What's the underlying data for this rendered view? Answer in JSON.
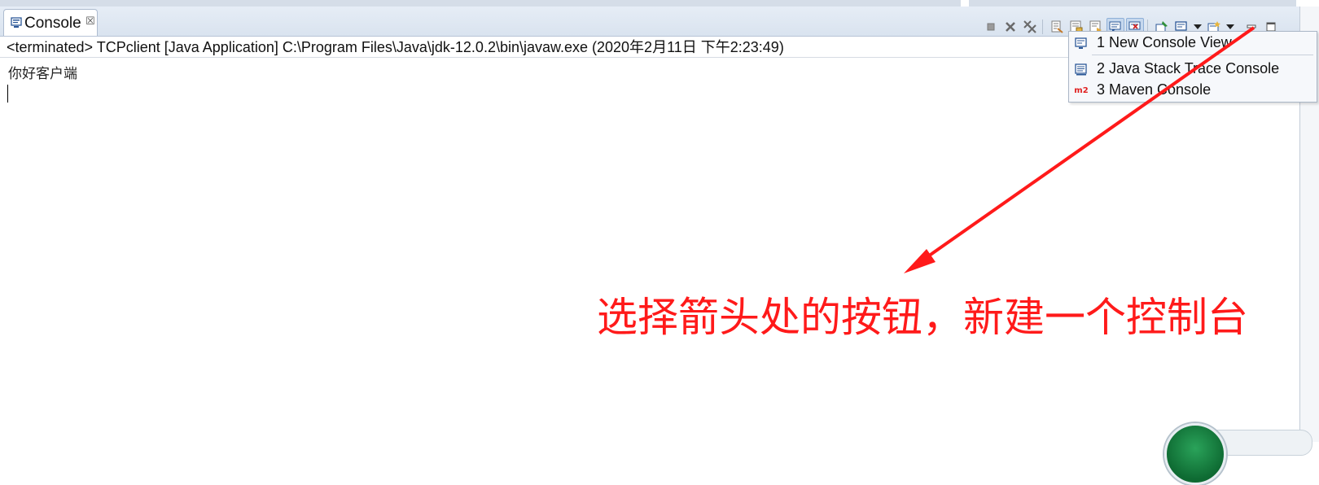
{
  "tab": {
    "label": "Console",
    "close_glyph": "☒"
  },
  "toolbar": {
    "icons": [
      "terminate-icon",
      "remove-launch-icon",
      "remove-all-terminated-icon",
      "clear-console-icon",
      "scroll-lock-icon",
      "word-wrap-icon",
      "show-on-stdout-icon",
      "show-on-stderr-icon",
      "pin-console-icon",
      "display-selected-console-icon",
      "display-dropdown-icon",
      "open-console-icon",
      "open-console-dropdown-icon",
      "minimize-icon",
      "maximize-icon"
    ]
  },
  "console": {
    "info_line": "<terminated> TCPclient [Java Application] C:\\Program Files\\Java\\jdk-12.0.2\\bin\\javaw.exe (2020年2月11日 下午2:23:49)",
    "output": [
      "你好客户端"
    ]
  },
  "menu": {
    "items": [
      {
        "label": "1 New Console View",
        "icon": "console-view-icon"
      },
      {
        "label": "2 Java Stack Trace Console",
        "icon": "stack-trace-console-icon"
      },
      {
        "label": "3 Maven Console",
        "icon": "maven-m2-icon",
        "icon_text": "m2"
      }
    ]
  },
  "annotation": {
    "text": "选择箭头处的按钮，新建一个控制台",
    "color": "#ff1a1a"
  },
  "colors": {
    "tabbar": "#dde6f1",
    "pressed_button": "#c6d8ee",
    "annotation_red": "#ff1a1a"
  }
}
